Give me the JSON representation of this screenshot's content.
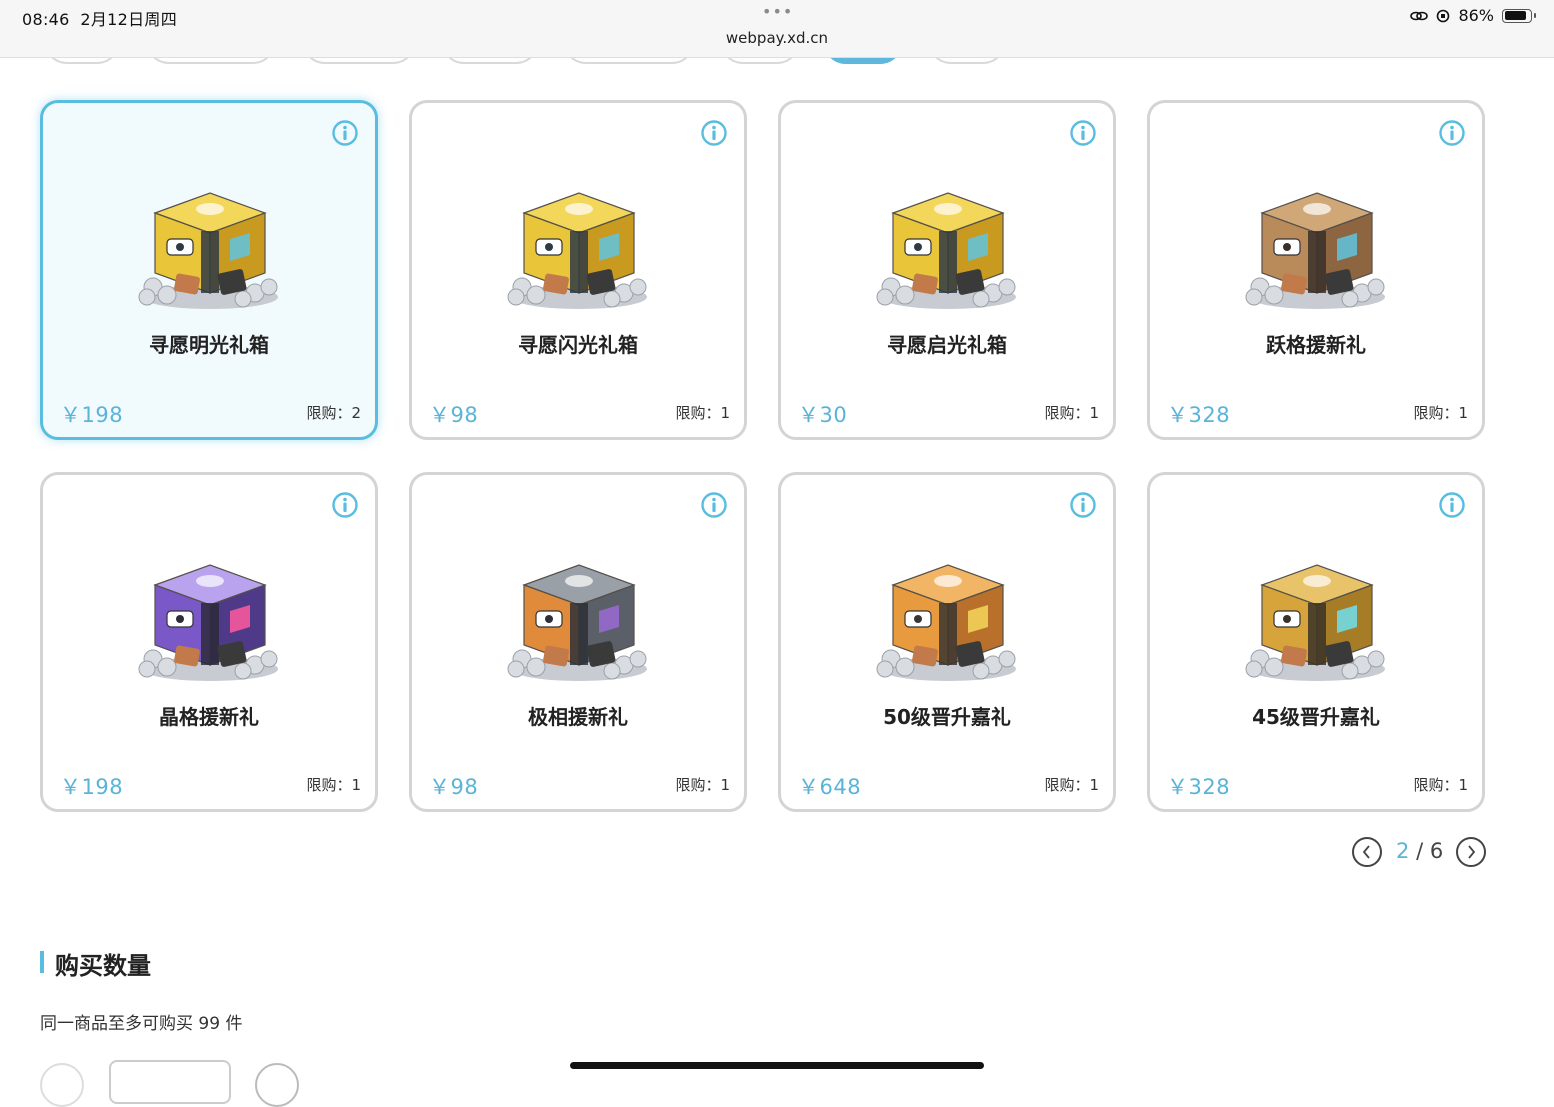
{
  "status_bar": {
    "time": "08:46",
    "date": "2月12日周四",
    "dots": "•••",
    "url": "webpay.xd.cn",
    "battery": "86%",
    "battery_level": 0.86
  },
  "tabs": {
    "active_index": 6,
    "count": 9
  },
  "products": [
    {
      "name": "寻愿明光礼箱",
      "price": "￥198",
      "limit": "限购：2",
      "selected": true,
      "chest": "yellow-crate"
    },
    {
      "name": "寻愿闪光礼箱",
      "price": "￥98",
      "limit": "限购：1",
      "selected": false,
      "chest": "yellow-crate"
    },
    {
      "name": "寻愿启光礼箱",
      "price": "￥30",
      "limit": "限购：1",
      "selected": false,
      "chest": "yellow-crate"
    },
    {
      "name": "跃格援新礼",
      "price": "￥328",
      "limit": "限购：1",
      "selected": false,
      "chest": "bronze-chest"
    },
    {
      "name": "晶格援新礼",
      "price": "￥198",
      "limit": "限购：1",
      "selected": false,
      "chest": "purple-chest"
    },
    {
      "name": "极相援新礼",
      "price": "￥98",
      "limit": "限购：1",
      "selected": false,
      "chest": "orange-gray-chest"
    },
    {
      "name": "50级晋升嘉礼",
      "price": "￥648",
      "limit": "限购：1",
      "selected": false,
      "chest": "orange-chest"
    },
    {
      "name": "45级晋升嘉礼",
      "price": "￥328",
      "limit": "限购：1",
      "selected": false,
      "chest": "gold-chest"
    }
  ],
  "pagination": {
    "current": "2",
    "separator": "/",
    "total": "6"
  },
  "quantity": {
    "title": "购买数量",
    "note": "同一商品至多可购买 99 件"
  },
  "colors": {
    "accent": "#5ab3d8",
    "card_border": "#d4d4d4",
    "selected_bg": "#f1fafd"
  }
}
